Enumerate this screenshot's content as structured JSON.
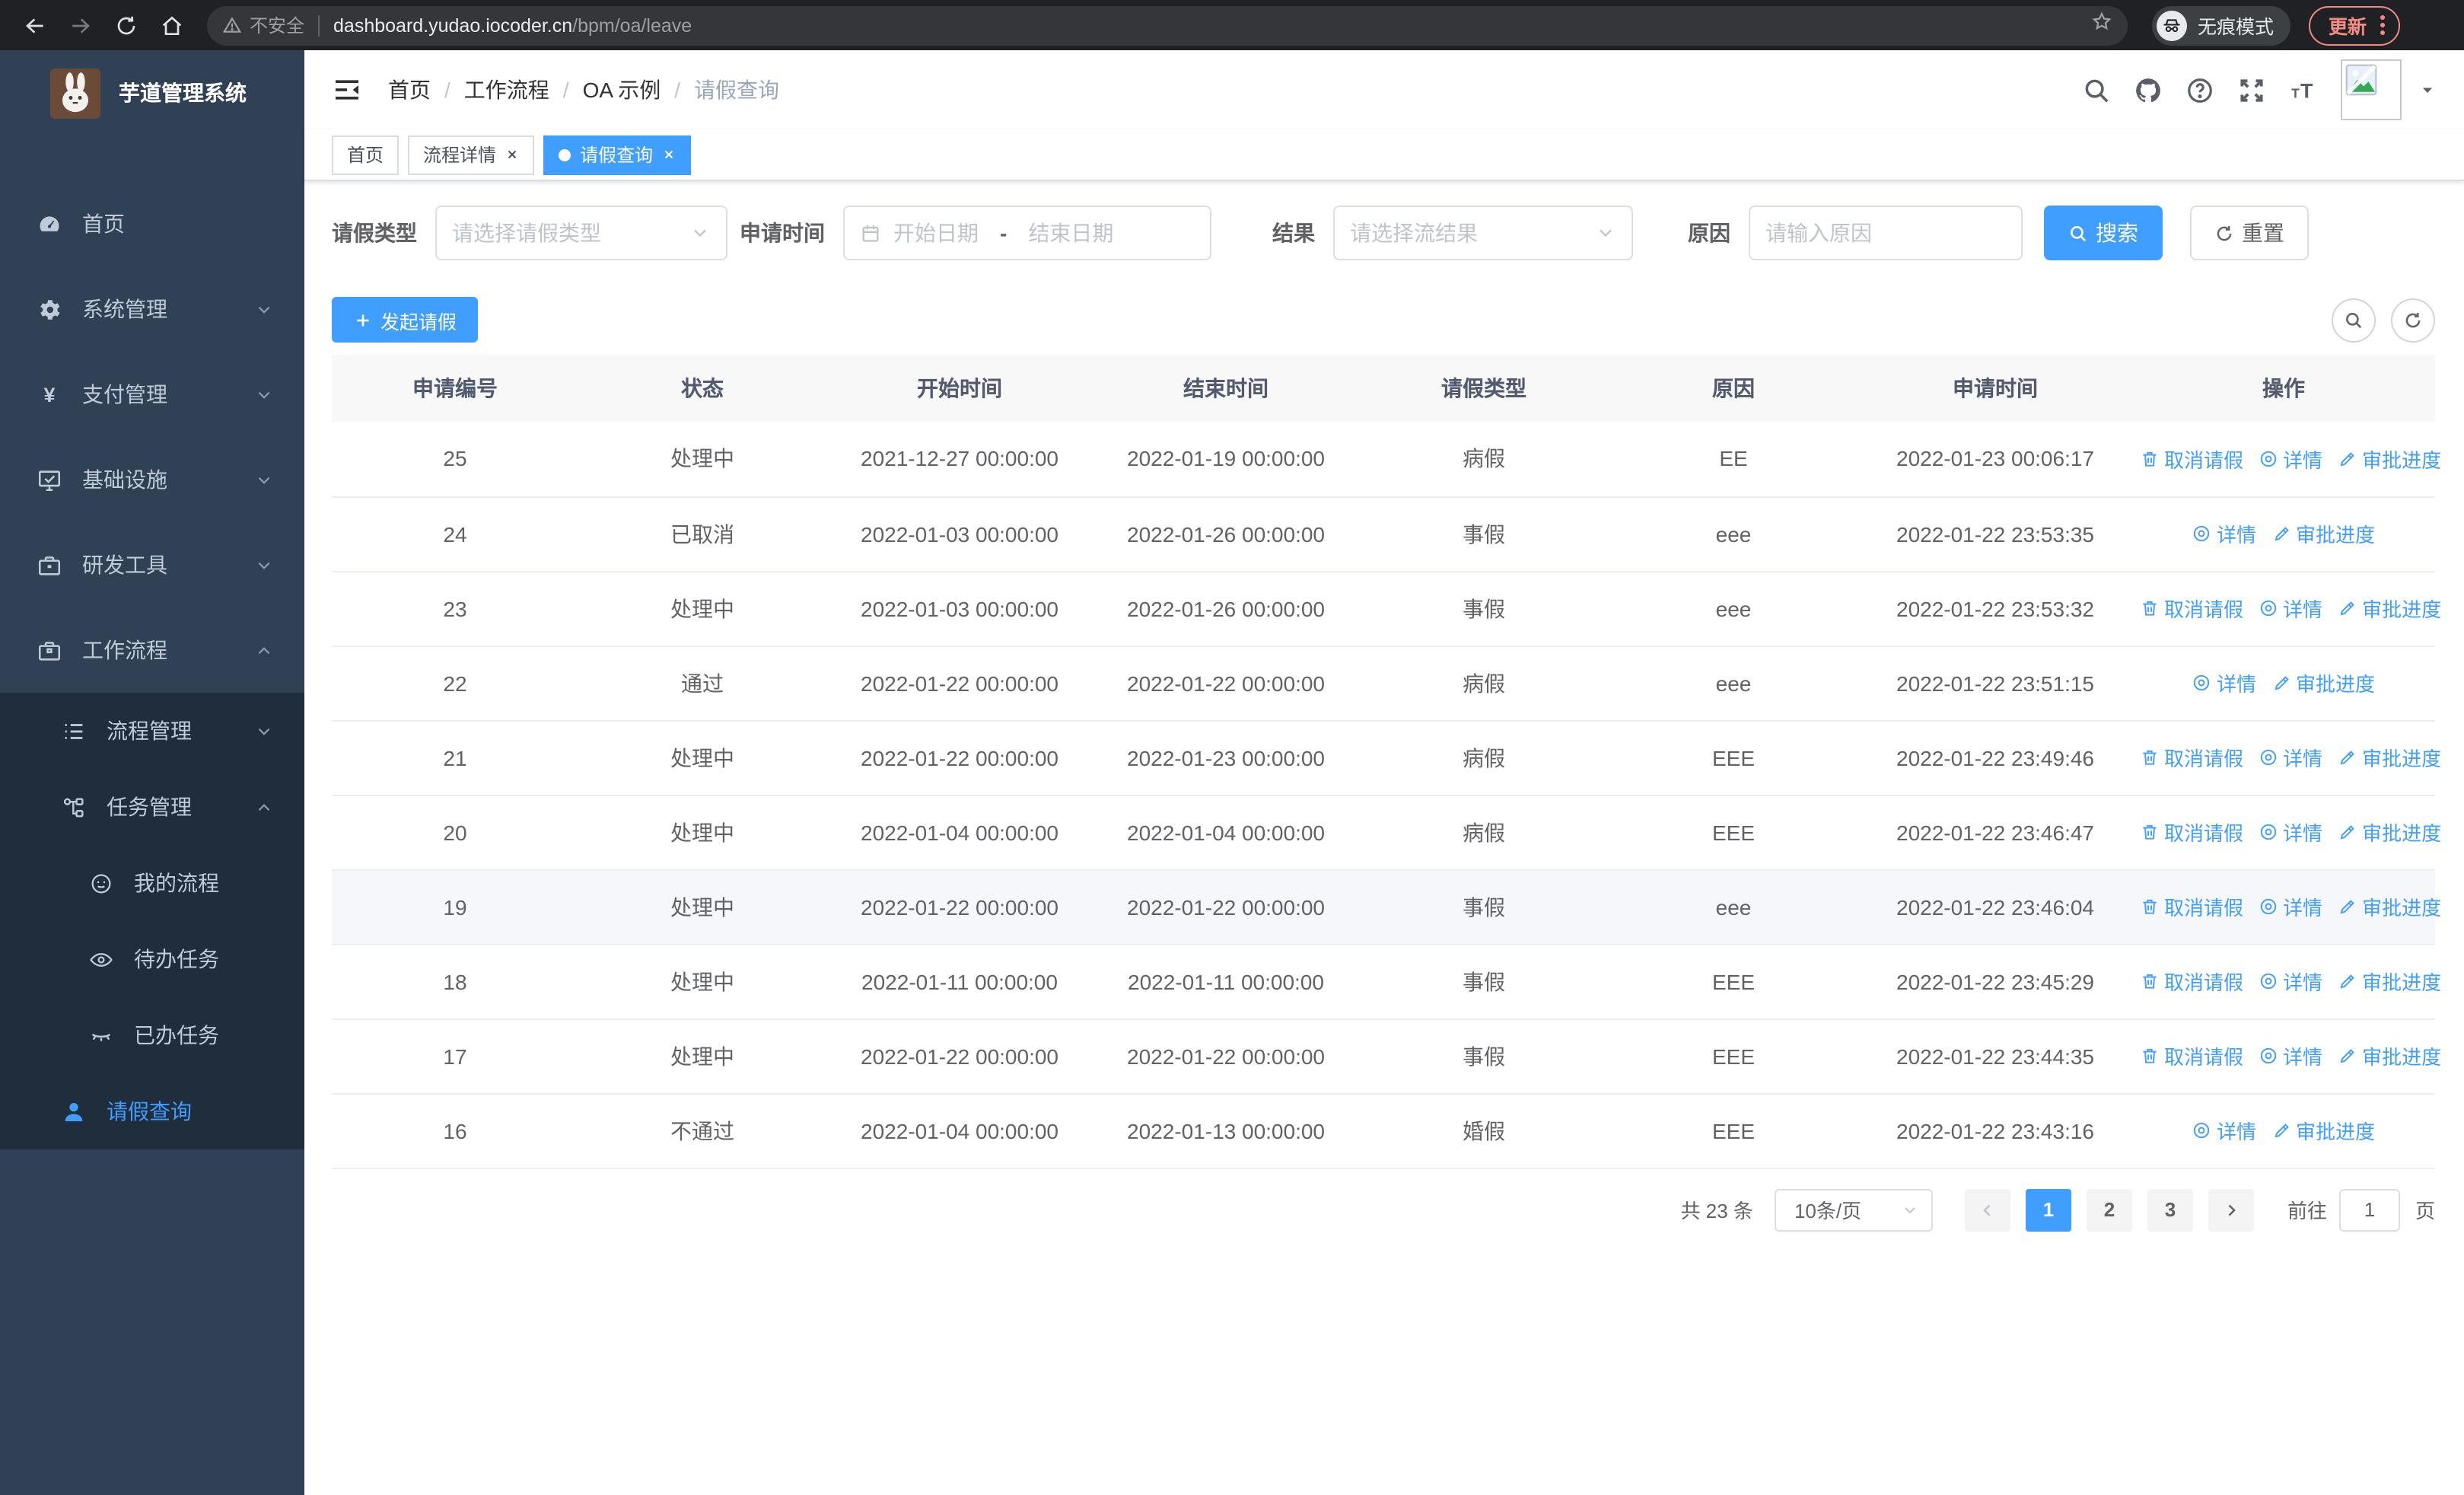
{
  "browser": {
    "security_label": "不安全",
    "url_host": "dashboard.yudao.iocoder.cn",
    "url_path": "/bpm/oa/leave",
    "incognito_label": "无痕模式",
    "update_label": "更新"
  },
  "sidebar": {
    "title": "芋道管理系统",
    "menu": [
      {
        "key": "home",
        "label": "首页",
        "icon": "dashboard-icon",
        "level": 1,
        "chevron": "",
        "dark": false,
        "active": false
      },
      {
        "key": "system",
        "label": "系统管理",
        "icon": "gear-icon",
        "level": 1,
        "chevron": "down",
        "dark": false,
        "active": false
      },
      {
        "key": "payment",
        "label": "支付管理",
        "icon": "yen-icon",
        "level": 1,
        "chevron": "down",
        "dark": false,
        "active": false
      },
      {
        "key": "infrastructure",
        "label": "基础设施",
        "icon": "monitor-icon",
        "level": 1,
        "chevron": "down",
        "dark": false,
        "active": false
      },
      {
        "key": "dev-tools",
        "label": "研发工具",
        "icon": "toolbox-icon",
        "level": 1,
        "chevron": "down",
        "dark": false,
        "active": false
      },
      {
        "key": "workflow",
        "label": "工作流程",
        "icon": "briefcase-icon",
        "level": 1,
        "chevron": "up",
        "dark": false,
        "active": false
      },
      {
        "key": "process-mgmt",
        "label": "流程管理",
        "icon": "list-tree-icon",
        "level": 2,
        "chevron": "down",
        "dark": true,
        "active": false
      },
      {
        "key": "task-mgmt",
        "label": "任务管理",
        "icon": "flow-icon",
        "level": 2,
        "chevron": "up",
        "dark": true,
        "active": false
      },
      {
        "key": "my-process",
        "label": "我的流程",
        "icon": "face-icon",
        "level": 3,
        "chevron": "",
        "dark": true,
        "active": false
      },
      {
        "key": "todo-task",
        "label": "待办任务",
        "icon": "eye-open-icon",
        "level": 3,
        "chevron": "",
        "dark": true,
        "active": false
      },
      {
        "key": "done-task",
        "label": "已办任务",
        "icon": "eye-closed-icon",
        "level": 3,
        "chevron": "",
        "dark": true,
        "active": false
      },
      {
        "key": "leave-query",
        "label": "请假查询",
        "icon": "user-icon",
        "level": 2,
        "chevron": "",
        "dark": true,
        "active": true
      }
    ]
  },
  "header": {
    "breadcrumb": [
      "首页",
      "工作流程",
      "OA 示例",
      "请假查询"
    ]
  },
  "tabs": [
    {
      "label": "首页",
      "active": false,
      "closable": false
    },
    {
      "label": "流程详情",
      "active": false,
      "closable": true
    },
    {
      "label": "请假查询",
      "active": true,
      "closable": true
    }
  ],
  "filters": {
    "leave_type": {
      "label": "请假类型",
      "placeholder": "请选择请假类型"
    },
    "apply_time": {
      "label": "申请时间",
      "start_placeholder": "开始日期",
      "separator": "-",
      "end_placeholder": "结束日期"
    },
    "result": {
      "label": "结果",
      "placeholder": "请选择流结果"
    },
    "reason": {
      "label": "原因",
      "placeholder": "请输入原因"
    },
    "search_label": "搜索",
    "reset_label": "重置"
  },
  "toolbar": {
    "create_label": "发起请假"
  },
  "table": {
    "headers": [
      "申请编号",
      "状态",
      "开始时间",
      "结束时间",
      "请假类型",
      "原因",
      "申请时间",
      "操作"
    ],
    "action_labels": {
      "cancel": "取消请假",
      "detail": "详情",
      "progress": "审批进度"
    },
    "rows": [
      {
        "id": "25",
        "status": "处理中",
        "start": "2021-12-27 00:00:00",
        "end": "2022-01-19 00:00:00",
        "type": "病假",
        "reason": "EE",
        "apply": "2022-01-23 00:06:17",
        "actions": [
          "cancel",
          "detail",
          "progress"
        ],
        "highlight": false
      },
      {
        "id": "24",
        "status": "已取消",
        "start": "2022-01-03 00:00:00",
        "end": "2022-01-26 00:00:00",
        "type": "事假",
        "reason": "eee",
        "apply": "2022-01-22 23:53:35",
        "actions": [
          "detail",
          "progress"
        ],
        "highlight": false
      },
      {
        "id": "23",
        "status": "处理中",
        "start": "2022-01-03 00:00:00",
        "end": "2022-01-26 00:00:00",
        "type": "事假",
        "reason": "eee",
        "apply": "2022-01-22 23:53:32",
        "actions": [
          "cancel",
          "detail",
          "progress"
        ],
        "highlight": false
      },
      {
        "id": "22",
        "status": "通过",
        "start": "2022-01-22 00:00:00",
        "end": "2022-01-22 00:00:00",
        "type": "病假",
        "reason": "eee",
        "apply": "2022-01-22 23:51:15",
        "actions": [
          "detail",
          "progress"
        ],
        "highlight": false
      },
      {
        "id": "21",
        "status": "处理中",
        "start": "2022-01-22 00:00:00",
        "end": "2022-01-23 00:00:00",
        "type": "病假",
        "reason": "EEE",
        "apply": "2022-01-22 23:49:46",
        "actions": [
          "cancel",
          "detail",
          "progress"
        ],
        "highlight": false
      },
      {
        "id": "20",
        "status": "处理中",
        "start": "2022-01-04 00:00:00",
        "end": "2022-01-04 00:00:00",
        "type": "病假",
        "reason": "EEE",
        "apply": "2022-01-22 23:46:47",
        "actions": [
          "cancel",
          "detail",
          "progress"
        ],
        "highlight": false
      },
      {
        "id": "19",
        "status": "处理中",
        "start": "2022-01-22 00:00:00",
        "end": "2022-01-22 00:00:00",
        "type": "事假",
        "reason": "eee",
        "apply": "2022-01-22 23:46:04",
        "actions": [
          "cancel",
          "detail",
          "progress"
        ],
        "highlight": true
      },
      {
        "id": "18",
        "status": "处理中",
        "start": "2022-01-11 00:00:00",
        "end": "2022-01-11 00:00:00",
        "type": "事假",
        "reason": "EEE",
        "apply": "2022-01-22 23:45:29",
        "actions": [
          "cancel",
          "detail",
          "progress"
        ],
        "highlight": false
      },
      {
        "id": "17",
        "status": "处理中",
        "start": "2022-01-22 00:00:00",
        "end": "2022-01-22 00:00:00",
        "type": "事假",
        "reason": "EEE",
        "apply": "2022-01-22 23:44:35",
        "actions": [
          "cancel",
          "detail",
          "progress"
        ],
        "highlight": false
      },
      {
        "id": "16",
        "status": "不通过",
        "start": "2022-01-04 00:00:00",
        "end": "2022-01-13 00:00:00",
        "type": "婚假",
        "reason": "EEE",
        "apply": "2022-01-22 23:43:16",
        "actions": [
          "detail",
          "progress"
        ],
        "highlight": false
      }
    ]
  },
  "pagination": {
    "total": "共 23 条",
    "page_size": "10条/页",
    "pages": [
      "1",
      "2",
      "3"
    ],
    "current": "1",
    "goto_label": "前往",
    "goto_value": "1",
    "unit_label": "页"
  },
  "colors": {
    "accent": "#409eff",
    "sidebar_bg": "#304156",
    "submenu_bg": "#1f2d3d",
    "update_accent": "#f28b82"
  }
}
